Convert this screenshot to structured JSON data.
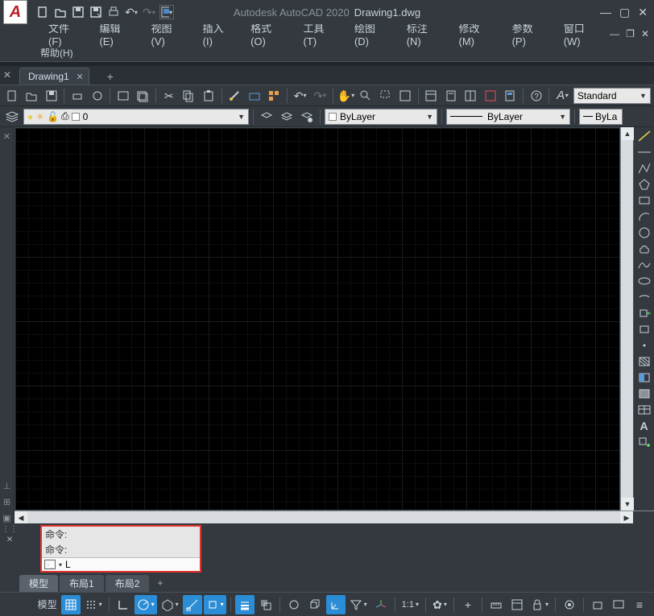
{
  "app": {
    "title": "Autodesk AutoCAD 2020",
    "filename": "Drawing1.dwg"
  },
  "menus": {
    "file": "文件(F)",
    "edit": "编辑(E)",
    "view": "视图(V)",
    "insert": "插入(I)",
    "format": "格式(O)",
    "tools": "工具(T)",
    "draw": "绘图(D)",
    "dimension": "标注(N)",
    "modify": "修改(M)",
    "parametric": "参数(P)",
    "window": "窗口(W)",
    "help": "帮助(H)"
  },
  "file_tab": {
    "name": "Drawing1"
  },
  "layer": {
    "current": "0"
  },
  "props": {
    "bylayer1": "ByLayer",
    "bylayer2": "ByLayer",
    "bylayer3": "ByLa"
  },
  "style_combo": "Standard",
  "cmd": {
    "hist1": "命令:",
    "hist2": "命令:",
    "input": "L"
  },
  "layouts": {
    "model": "模型",
    "layout1": "布局1",
    "layout2": "布局2"
  },
  "status": {
    "model": "模型",
    "ratio": "1:1"
  }
}
